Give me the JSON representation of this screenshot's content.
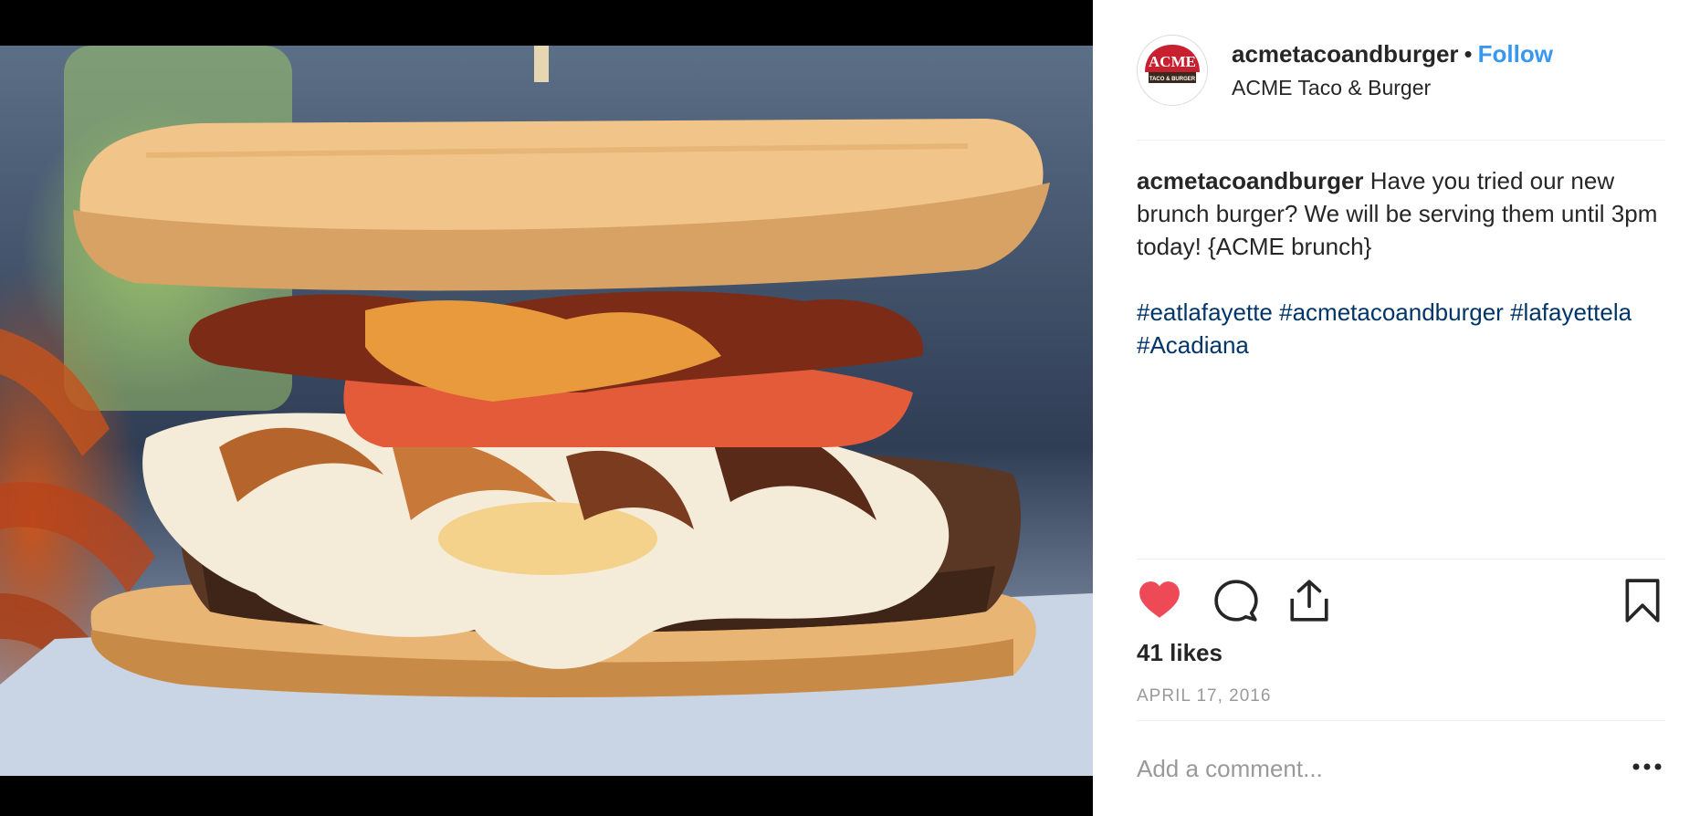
{
  "post": {
    "image_alt": "ACME brunch burger",
    "account": {
      "username": "acmetacoandburger",
      "separator": "•",
      "follow_label": "Follow",
      "location": "ACME Taco & Burger",
      "avatar_logo": {
        "top_text": "ACME",
        "bottom_text": "TACO & BURGER"
      }
    },
    "caption": {
      "username": "acmetacoandburger",
      "text": "Have you tried our new brunch burger? We will be serving them until 3pm today! {ACME brunch}",
      "hashtags": [
        "#eatlafayette",
        "#acmetacoandburger",
        "#lafayettela",
        "#Acadiana"
      ]
    },
    "actions": {
      "like_icon": "heart-filled-icon",
      "comment_icon": "comment-bubble-icon",
      "share_icon": "share-upload-icon",
      "save_icon": "bookmark-icon"
    },
    "likes_text": "41 likes",
    "date": "APRIL 17, 2016",
    "comment": {
      "placeholder": "Add a comment...",
      "more_icon": "more-options-icon"
    }
  },
  "colors": {
    "follow": "#3897f0",
    "hashtag": "#003569",
    "like": "#ed4956",
    "muted": "#999999",
    "text": "#262626",
    "logo_red": "#c8202f"
  }
}
